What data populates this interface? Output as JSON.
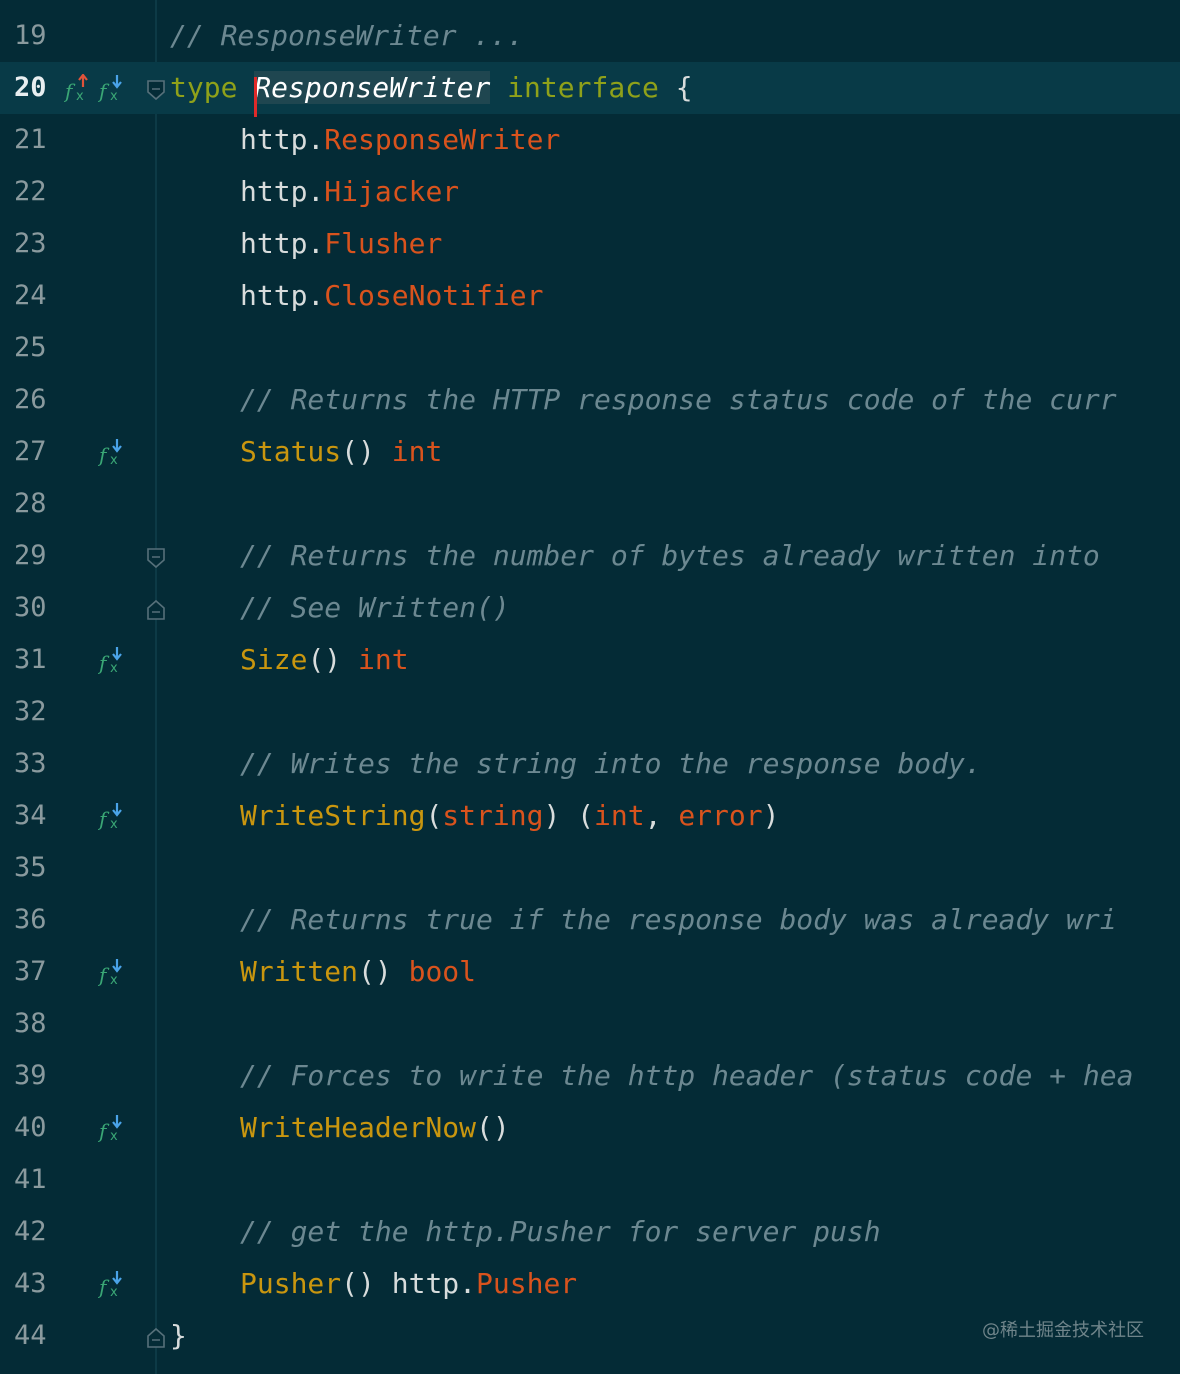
{
  "editor": {
    "current_line": 20,
    "lines": [
      {
        "num": "19",
        "segments": [
          {
            "t": "// ResponseWriter ...",
            "c": "cmt"
          }
        ]
      },
      {
        "num": "20",
        "segments": [
          {
            "t": "type",
            "c": "kw"
          },
          {
            "t": " ",
            "c": "plain"
          },
          {
            "t": "ResponseWriter",
            "c": "sel"
          },
          {
            "t": " ",
            "c": "plain"
          },
          {
            "t": "interface",
            "c": "kw"
          },
          {
            "t": " {",
            "c": "plain"
          }
        ]
      },
      {
        "num": "21",
        "segments": [
          {
            "t": "http.",
            "c": "plain"
          },
          {
            "t": "ResponseWriter",
            "c": "ty"
          }
        ]
      },
      {
        "num": "22",
        "segments": [
          {
            "t": "http.",
            "c": "plain"
          },
          {
            "t": "Hijacker",
            "c": "ty"
          }
        ]
      },
      {
        "num": "23",
        "segments": [
          {
            "t": "http.",
            "c": "plain"
          },
          {
            "t": "Flusher",
            "c": "ty"
          }
        ]
      },
      {
        "num": "24",
        "segments": [
          {
            "t": "http.",
            "c": "plain"
          },
          {
            "t": "CloseNotifier",
            "c": "ty"
          }
        ]
      },
      {
        "num": "25",
        "segments": []
      },
      {
        "num": "26",
        "segments": [
          {
            "t": "// Returns the HTTP response status code of the curr",
            "c": "cmt"
          }
        ]
      },
      {
        "num": "27",
        "segments": [
          {
            "t": "Status",
            "c": "fn"
          },
          {
            "t": "() ",
            "c": "plain"
          },
          {
            "t": "int",
            "c": "ty"
          }
        ]
      },
      {
        "num": "28",
        "segments": []
      },
      {
        "num": "29",
        "segments": [
          {
            "t": "// Returns the number of bytes already written into",
            "c": "cmt"
          }
        ]
      },
      {
        "num": "30",
        "segments": [
          {
            "t": "// See Written()",
            "c": "cmt"
          }
        ]
      },
      {
        "num": "31",
        "segments": [
          {
            "t": "Size",
            "c": "fn"
          },
          {
            "t": "() ",
            "c": "plain"
          },
          {
            "t": "int",
            "c": "ty"
          }
        ]
      },
      {
        "num": "32",
        "segments": []
      },
      {
        "num": "33",
        "segments": [
          {
            "t": "// Writes the string into the response body.",
            "c": "cmt"
          }
        ]
      },
      {
        "num": "34",
        "segments": [
          {
            "t": "WriteString",
            "c": "fn"
          },
          {
            "t": "(",
            "c": "plain"
          },
          {
            "t": "string",
            "c": "ty"
          },
          {
            "t": ") (",
            "c": "plain"
          },
          {
            "t": "int",
            "c": "ty"
          },
          {
            "t": ", ",
            "c": "plain"
          },
          {
            "t": "error",
            "c": "ty"
          },
          {
            "t": ")",
            "c": "plain"
          }
        ]
      },
      {
        "num": "35",
        "segments": []
      },
      {
        "num": "36",
        "segments": [
          {
            "t": "// Returns true if the response body was already wri",
            "c": "cmt"
          }
        ]
      },
      {
        "num": "37",
        "segments": [
          {
            "t": "Written",
            "c": "fn"
          },
          {
            "t": "() ",
            "c": "plain"
          },
          {
            "t": "bool",
            "c": "ty"
          }
        ]
      },
      {
        "num": "38",
        "segments": []
      },
      {
        "num": "39",
        "segments": [
          {
            "t": "// Forces to write the http header (status code + hea",
            "c": "cmt"
          }
        ]
      },
      {
        "num": "40",
        "segments": [
          {
            "t": "WriteHeaderNow",
            "c": "fn"
          },
          {
            "t": "()",
            "c": "plain"
          }
        ]
      },
      {
        "num": "41",
        "segments": []
      },
      {
        "num": "42",
        "segments": [
          {
            "t": "// get the http.Pusher for server push",
            "c": "cmt"
          }
        ]
      },
      {
        "num": "43",
        "segments": [
          {
            "t": "Pusher",
            "c": "fn"
          },
          {
            "t": "() http.",
            "c": "plain"
          },
          {
            "t": "Pusher",
            "c": "ty"
          }
        ]
      },
      {
        "num": "44",
        "segments": [
          {
            "t": "}",
            "c": "plain"
          }
        ]
      }
    ]
  },
  "watermark": "@稀土掘金技术社区",
  "colors": {
    "background": "#042b36",
    "current_line_bg": "#083a47",
    "keyword": "#8fa11a",
    "type": "#d9531d",
    "function": "#c9960f",
    "comment": "#6c8891",
    "text": "#d8dcdc",
    "icon_green": "#3aa675",
    "icon_blue": "#4aa3e8",
    "icon_red": "#e0533a"
  }
}
